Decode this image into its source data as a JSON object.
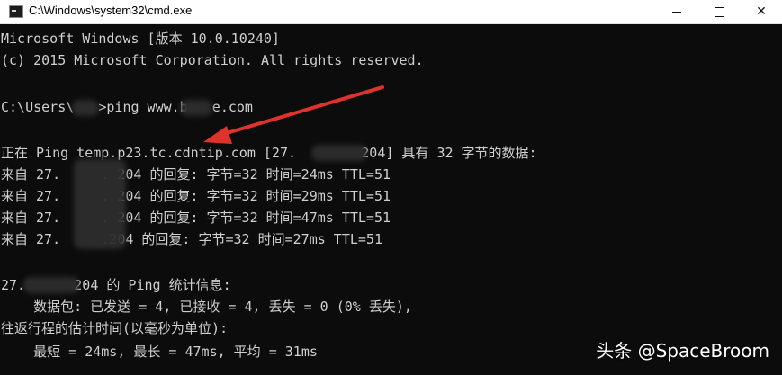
{
  "window": {
    "title": "C:\\Windows\\system32\\cmd.exe",
    "minimize_glyph": "",
    "close_glyph": "✕"
  },
  "console": {
    "lines": [
      "Microsoft Windows [版本 10.0.10240]",
      "(c) 2015 Microsoft Corporation. All rights reserved.",
      "",
      "C:\\Users\\   >ping www.b   e.com",
      "",
      "正在 Ping temp.p23.tc.cdntip.com [27.        204] 具有 32 字节的数据:",
      "来自 27.     . 204 的回复: 字节=32 时间=24ms TTL=51",
      "来自 27.     . 204 的回复: 字节=32 时间=29ms TTL=51",
      "来自 27.     . 204 的回复: 字节=32 时间=47ms TTL=51",
      "来自 27.     .204 的回复: 字节=32 时间=27ms TTL=51",
      "",
      "27.      204 的 Ping 统计信息:",
      "    数据包: 已发送 = 4, 已接收 = 4, 丢失 = 0 (0% 丢失),",
      "往返行程的估计时间(以毫秒为单位):",
      "    最短 = 24ms, 最长 = 47ms, 平均 = 31ms"
    ]
  },
  "colors": {
    "console_bg": "#0c0c0c",
    "console_text": "#cfcfcf",
    "annotation_arrow": "#e0322c"
  },
  "watermark": {
    "text": "头条 @SpaceBroom"
  }
}
